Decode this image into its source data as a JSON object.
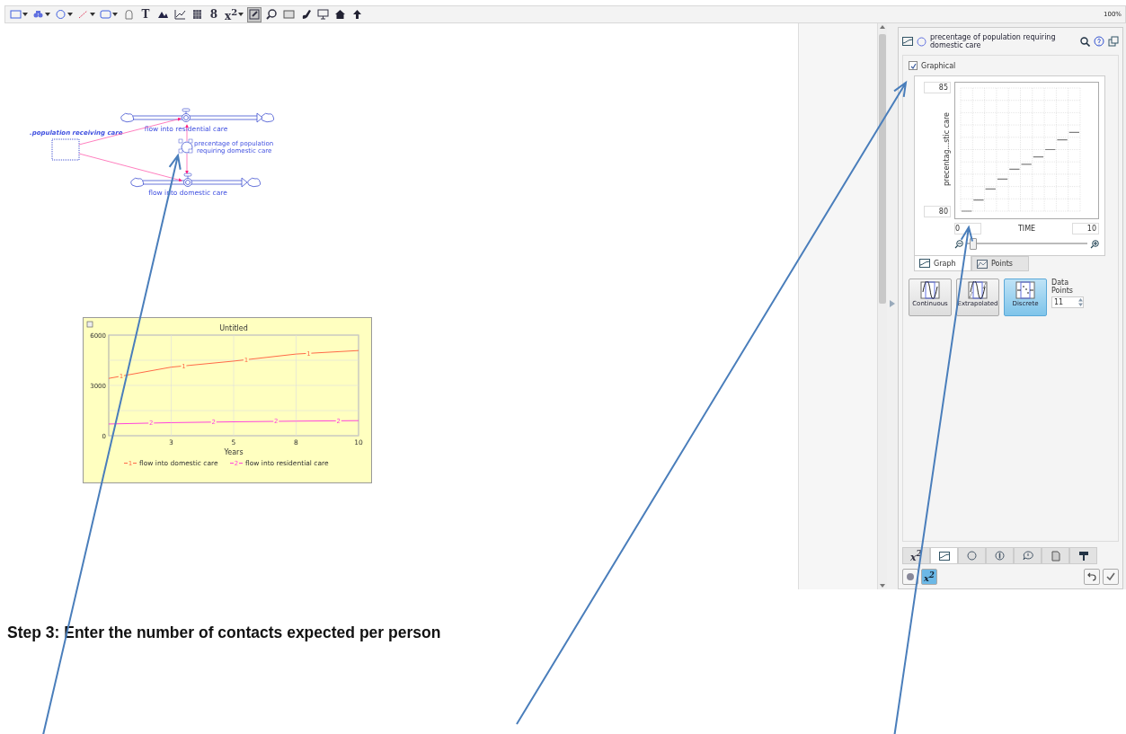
{
  "toolbar": {
    "tools": [
      {
        "kind": "stock",
        "dropdown": true,
        "selected": false
      },
      {
        "kind": "flow",
        "dropdown": true,
        "selected": false
      },
      {
        "kind": "converter",
        "dropdown": true,
        "selected": false
      },
      {
        "kind": "connector",
        "dropdown": true,
        "selected": false
      },
      {
        "kind": "module",
        "dropdown": true,
        "selected": false
      },
      {
        "kind": "ghost",
        "dropdown": false,
        "selected": false
      },
      {
        "kind": "text",
        "glyph": "T",
        "dropdown": false,
        "selected": false
      },
      {
        "kind": "image",
        "dropdown": false,
        "selected": false
      },
      {
        "kind": "graph",
        "dropdown": false,
        "selected": false
      },
      {
        "kind": "table",
        "dropdown": false,
        "selected": false
      },
      {
        "kind": "numeric",
        "glyph": "8",
        "dropdown": false,
        "selected": false
      },
      {
        "kind": "equation",
        "glyph": "x$^{2}$",
        "dropdown": true,
        "selected": false
      },
      {
        "kind": "edit",
        "dropdown": false,
        "selected": true
      },
      {
        "kind": "zoom",
        "dropdown": false,
        "selected": false
      },
      {
        "kind": "panel",
        "dropdown": false,
        "selected": false
      },
      {
        "kind": "pen",
        "dropdown": false,
        "selected": false
      },
      {
        "kind": "presentation",
        "dropdown": false,
        "selected": false
      },
      {
        "kind": "home",
        "dropdown": false,
        "selected": false
      },
      {
        "kind": "up",
        "dropdown": false,
        "selected": false
      }
    ],
    "zoom": "100%"
  },
  "diagram": {
    "stock": {
      "label": ".population receiving care"
    },
    "flows": [
      {
        "label": "flow into residential care"
      },
      {
        "label": "flow into domestic care"
      }
    ],
    "converter": {
      "lines": [
        "precentage of population",
        "requiring domestic care"
      ],
      "selected": true
    }
  },
  "plot": {
    "line_marks": [
      {
        "points": [
          "1",
          "1",
          "1",
          "1"
        ],
        "legend": "1"
      },
      {
        "points": [
          "2",
          "2",
          "2",
          "2"
        ],
        "legend": "2"
      }
    ],
    "chart_data": {
      "type": "line",
      "grid": true,
      "legend": true,
      "title": "Untitled",
      "xlabel": "Years",
      "x": [
        0,
        2.5,
        5,
        7.5,
        10
      ],
      "series": [
        {
          "name": "flow into domestic care",
          "color": "#ff6a48",
          "values": [
            3420,
            4090,
            4450,
            4870,
            5080
          ]
        },
        {
          "name": "flow into residential care",
          "color": "#ff44dd",
          "values": [
            700,
            780,
            830,
            870,
            900
          ]
        }
      ],
      "xlim": [
        0,
        10
      ],
      "ylim": [
        0,
        6000
      ],
      "xticks": [
        {
          "value": 2.5,
          "label": "3"
        },
        {
          "value": 5,
          "label": "5"
        },
        {
          "value": 7.5,
          "label": "8"
        },
        {
          "value": 10,
          "label": "10"
        }
      ],
      "yticks": [
        0,
        3000,
        6000
      ]
    }
  },
  "panel": {
    "title": "precentage of population requiring domestic care",
    "graphical": {
      "label": "Graphical",
      "checked": true
    },
    "graph": {
      "y_max": "85",
      "y_min": "80",
      "y_label": "precentag...stic care",
      "x_min": "0",
      "x_label": "TIME",
      "x_max": "10",
      "zoom": {
        "level": 0.03
      }
    },
    "view_tabs": [
      {
        "label": "Graph",
        "selected": true
      },
      {
        "label": "Points",
        "selected": false
      }
    ],
    "modes": [
      {
        "kind": "continuous",
        "label": "Continuous",
        "selected": false
      },
      {
        "kind": "extrapolated",
        "label": "Extrapolated",
        "selected": false
      },
      {
        "kind": "discrete",
        "label": "Discrete",
        "selected": true
      }
    ],
    "data_points": {
      "label": "Data Points",
      "value": "11"
    },
    "bottom_tabs": [
      {
        "kind": "equation",
        "glyph": "x$^{2}$",
        "selected": false
      },
      {
        "kind": "graph",
        "selected": true
      },
      {
        "kind": "circle",
        "selected": false
      },
      {
        "kind": "info",
        "selected": false
      },
      {
        "kind": "comment",
        "selected": false
      },
      {
        "kind": "document",
        "selected": false
      },
      {
        "kind": "paint",
        "selected": false
      }
    ],
    "footer": {
      "equation": "x$^{2}$"
    }
  },
  "caption": "Step 3: Enter the number of contacts expected per person"
}
